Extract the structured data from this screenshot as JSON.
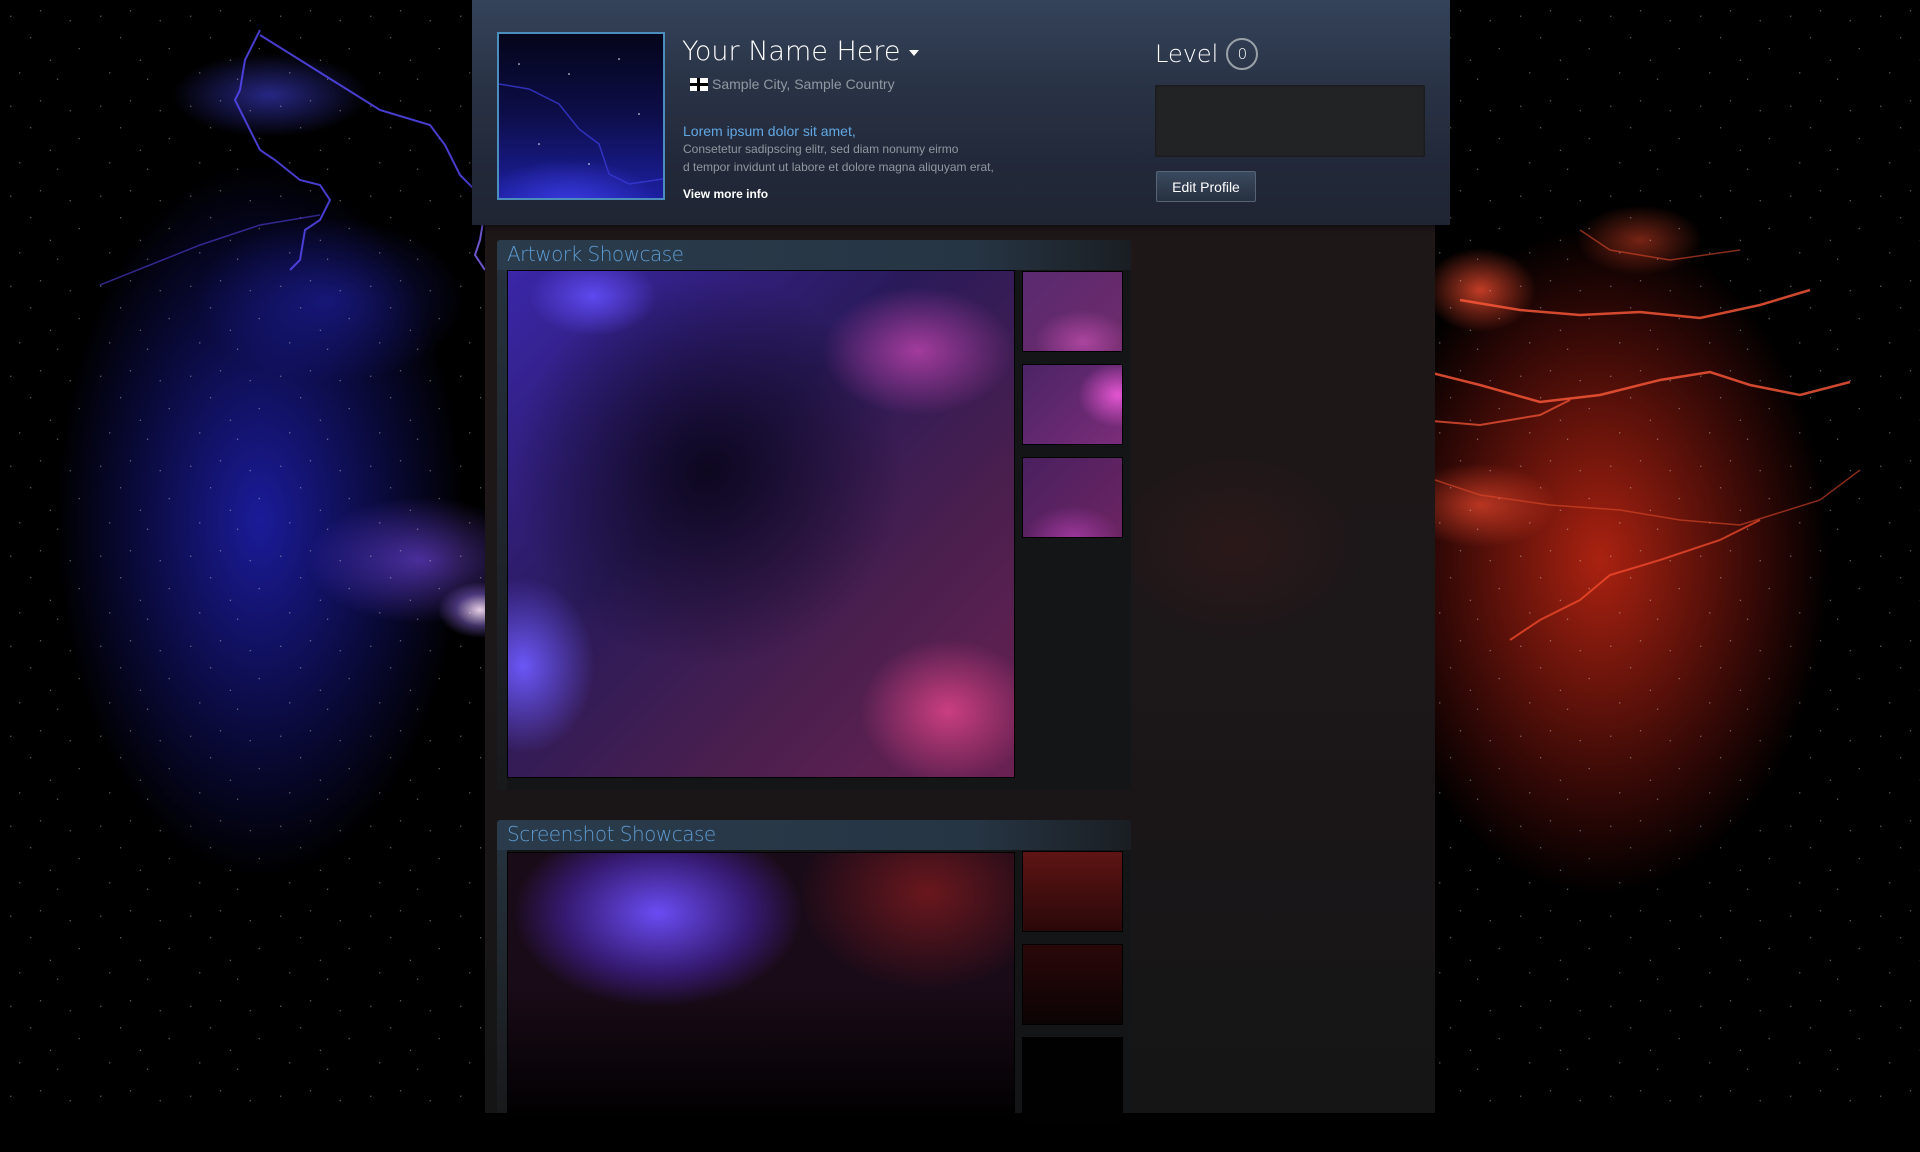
{
  "profile": {
    "name": "Your Name Here",
    "location": "Sample City, Sample Country",
    "summary_headline": "Lorem ipsum dolor sit amet,",
    "summary_lines": [
      "Consetetur sadipscing elitr, sed diam nonumy eirmo",
      "d tempor invidunt ut labore et dolore magna aliquyam erat,"
    ],
    "view_more_label": "View more info",
    "avatar_icon": "avatar-image"
  },
  "level": {
    "label": "Level",
    "value": "0"
  },
  "actions": {
    "edit_profile_label": "Edit Profile"
  },
  "showcases": [
    {
      "title": "Artwork Showcase",
      "thumbnail_count": 3
    },
    {
      "title": "Screenshot Showcase",
      "thumbnail_count": 3
    }
  ],
  "colors": {
    "accent_link": "#62a7e3",
    "showcase_title": "#5e9cd3",
    "avatar_border": "#4b8ebd",
    "background_left": "#2a2ab8",
    "background_right": "#c8281a"
  }
}
